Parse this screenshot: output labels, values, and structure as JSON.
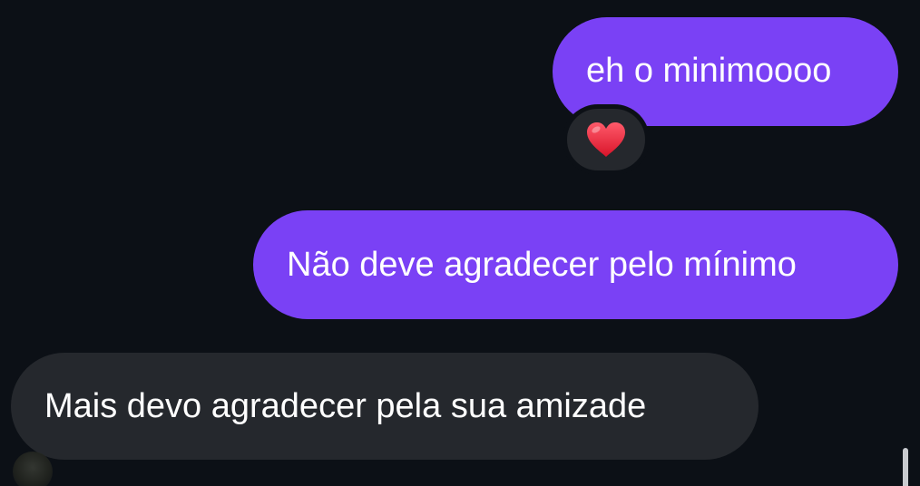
{
  "messages": [
    {
      "direction": "sent",
      "text": "eh o minimoooo",
      "reaction": "❤️"
    },
    {
      "direction": "sent",
      "text": "Não deve agradecer pelo mínimo"
    },
    {
      "direction": "received",
      "text": "Mais devo agradecer pela sua amizade"
    }
  ],
  "colors": {
    "background": "#0c1016",
    "sent_bubble": "#7a41f5",
    "received_bubble": "#25282d",
    "reaction_heart": "#e8283a"
  },
  "icons": {
    "reaction": "heart-icon"
  }
}
